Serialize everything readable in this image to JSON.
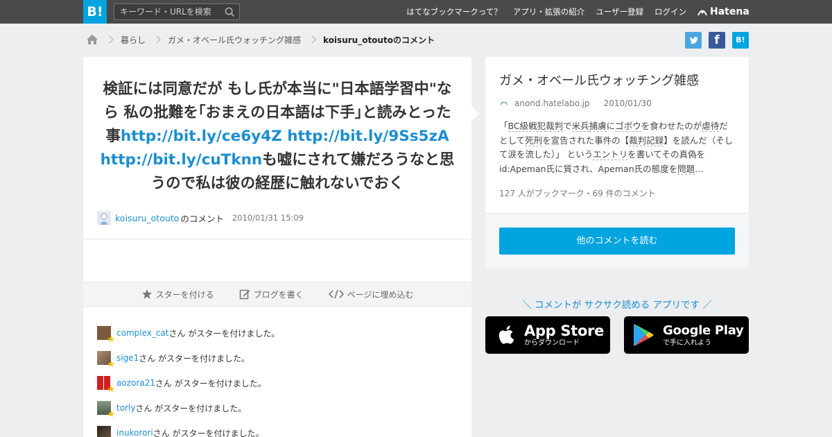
{
  "header": {
    "logo": "B!",
    "search_placeholder": "キーワード・URLを検索",
    "nav": [
      "はてなブックマークって？",
      "アプリ・拡張の紹介",
      "ユーザー登録",
      "ログイン"
    ],
    "brand": "Hatena"
  },
  "breadcrumb": {
    "items": [
      "暮らし",
      "ガメ・オベール氏ウォッチング雑感"
    ],
    "current": "koisuru_otoutoのコメント"
  },
  "share": {
    "twitter": "t",
    "facebook": "f",
    "hatena": "B!"
  },
  "comment": {
    "t1": "検証には同意だが もし氏が本当に\"日本語学習中\"なら 私の批難を｢おまえの日本語は下手｣と読みとった事",
    "l1": "http://bit.ly/ce6y4Z",
    "l2": "http://bit.ly/9Ss5zA",
    "l3": "http://bit.ly/cuTknn",
    "t2": "も嘘にされて嫌だろうなと思うので私は彼の経歴に触れないでおく",
    "user": "koisuru_otouto",
    "suffix": "のコメント",
    "date": "2010/01/31 15:09"
  },
  "actions": {
    "star": "スターを付ける",
    "blog": "ブログを書く",
    "embed": "ページに埋め込む"
  },
  "stars": [
    {
      "user": "complex_cat",
      "text": "さん がスターを付けました。",
      "color": "#7a5a3a"
    },
    {
      "user": "sige1",
      "text": "さん がスターを付けました。",
      "color": "#8a6a50"
    },
    {
      "user": "aozora21",
      "text": "さん がスターを付けました。",
      "color": "#d21e1e"
    },
    {
      "user": "torly",
      "text": "さん がスターを付けました。",
      "color": "#6a7a6a"
    },
    {
      "user": "inukorori",
      "text": "さん がスターを付けました。",
      "color": "#4a3a2a"
    }
  ],
  "entry": {
    "title": "ガメ・オベール氏ウォッチング雑感",
    "site": "anond.hatelabo.jp",
    "date": "2010/01/30",
    "d1": "「",
    "d2": "BC級戦犯",
    "d3": "裁判",
    "d4": "で",
    "d5": "米兵",
    "d6": "捕虜",
    "d7": "に",
    "d8": "ゴボウ",
    "d9": "を食わせたのが",
    "d10": "虐待",
    "d11": "だとして",
    "d12": "死刑",
    "d13": "を宣告された事件の【",
    "d14": "裁判記録",
    "d15": "】を読んだ（そして涙を流した）」 という",
    "d16": "エントリ",
    "d17": "を書いてその真偽をid:Apeman氏に質され、Apeman氏の態度を",
    "d18": "問題",
    "d19": "…",
    "count": "127 人がブックマーク・69 件のコメント",
    "read_more": "他のコメントを読む"
  },
  "promo": {
    "text": "＼ コメントが サクサク読める アプリです ／",
    "appstore_big": "App Store",
    "appstore_small": "からダウンロード",
    "gplay_big": "Google Play",
    "gplay_small": "で手に入れよう"
  }
}
